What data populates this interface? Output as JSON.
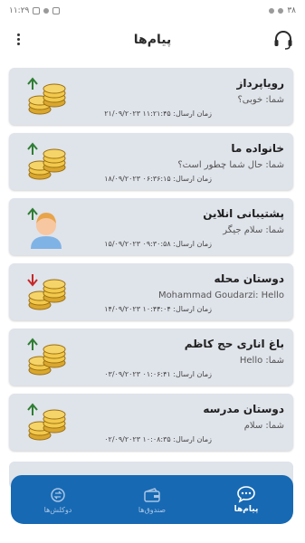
{
  "statusbar": {
    "time": "۱۱:۲۹",
    "battery": "۳۸"
  },
  "header": {
    "title": "پیام‌ها"
  },
  "conversations": [
    {
      "name": "رویاپرداز",
      "last": "شما: خوبی؟",
      "time": "زمان ارسال: ۱۱:۲۱:۴۵ ۲۱/۰۹/۲۰۲۳",
      "icon": "coins-icon",
      "direction": "up"
    },
    {
      "name": "خانواده ما",
      "last": "شما: حال شما چطور است؟",
      "time": "زمان ارسال: ۰۶:۳۶:۱۵ ۱۸/۰۹/۲۰۲۳",
      "icon": "coins-icon",
      "direction": "up"
    },
    {
      "name": "پشتیبانی انلاین",
      "last": "شما: سلام جیگر",
      "time": "زمان ارسال: ۰۹:۳۰:۵۸ ۱۵/۰۹/۲۰۲۳",
      "icon": "avatar-icon",
      "direction": "up"
    },
    {
      "name": "دوستان محله",
      "last": "Mohammad Goudarzi: Hello",
      "time": "زمان ارسال: ۱۰:۴۴:۰۴ ۱۴/۰۹/۲۰۲۳",
      "icon": "coins-icon",
      "direction": "down"
    },
    {
      "name": "باغ اناری حج کاظم",
      "last": "شما: Hello",
      "time": "زمان ارسال: ۰۱:۰۶:۴۱ ۰۳/۰۹/۲۰۲۳",
      "icon": "coins-icon",
      "direction": "up"
    },
    {
      "name": "دوستان مدرسه",
      "last": "شما: سلام",
      "time": "زمان ارسال: ۱۰:۰۸:۳۵ ۰۲/۰۹/۲۰۲۳",
      "icon": "coins-icon",
      "direction": "up"
    }
  ],
  "bottom_nav": [
    {
      "label": "پیام‌ها",
      "icon": "chat-icon",
      "active": true
    },
    {
      "label": "صندوق‌ها",
      "icon": "wallet-icon",
      "active": false
    },
    {
      "label": "دوکلش‌ها",
      "icon": "exchange-icon",
      "active": false
    }
  ],
  "colors": {
    "card": "#dfe3ea",
    "nav": "#1769b3",
    "arrow_up": "#2e7d32",
    "arrow_down": "#c62828"
  }
}
